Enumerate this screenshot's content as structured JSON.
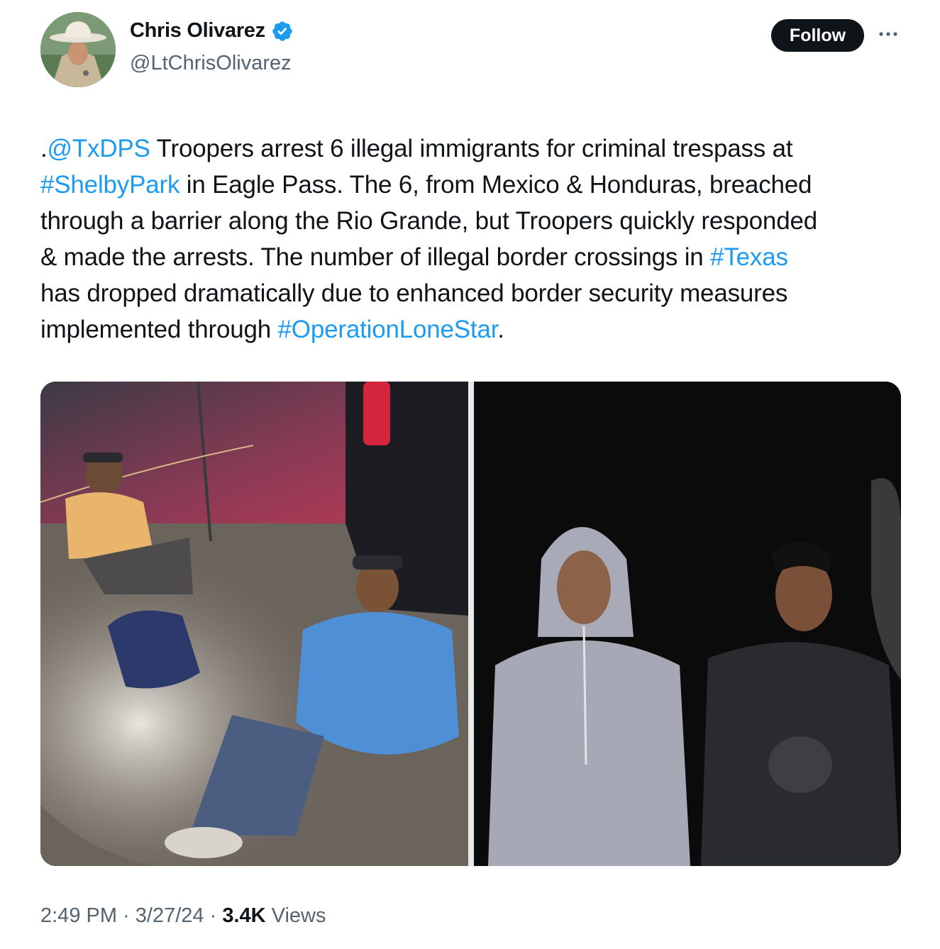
{
  "author": {
    "display_name": "Chris Olivarez",
    "handle": "@LtChrisOlivarez",
    "verified_icon": "verified-badge-icon",
    "avatar_icon": "profile-photo"
  },
  "actions": {
    "follow_label": "Follow",
    "more_icon": "more-options-icon"
  },
  "tweet": {
    "lines": [
      [
        {
          "text": ".",
          "link": false
        },
        {
          "text": "@TxDPS",
          "link": true
        },
        {
          "text": " Troopers arrest 6 illegal immigrants for criminal trespass at",
          "link": false
        }
      ],
      [
        {
          "text": "#ShelbyPark",
          "link": true
        },
        {
          "text": " in Eagle Pass. The 6, from Mexico & Honduras, breached",
          "link": false
        }
      ],
      [
        {
          "text": "through a barrier along the Rio Grande, but Troopers quickly responded",
          "link": false
        }
      ],
      [
        {
          "text": "& made the arrests. The number of illegal border crossings in ",
          "link": false
        },
        {
          "text": "#Texas",
          "link": true
        }
      ],
      [
        {
          "text": "has dropped dramatically due to enhanced border security measures",
          "link": false
        }
      ],
      [
        {
          "text": "implemented through ",
          "link": false
        },
        {
          "text": "#OperationLoneStar",
          "link": true
        },
        {
          "text": ".",
          "link": false
        }
      ]
    ]
  },
  "media": [
    {
      "name": "photo-two-men-seated-by-vehicle"
    },
    {
      "name": "photo-two-young-men-standing"
    }
  ],
  "meta": {
    "time": "2:49 PM",
    "separator": " · ",
    "date": "3/27/24",
    "views_count": "3.4K",
    "views_label": " Views"
  },
  "colors": {
    "text": "#0f1419",
    "secondary": "#536471",
    "link": "#1d9bf0",
    "follow_bg": "#0f1419"
  }
}
